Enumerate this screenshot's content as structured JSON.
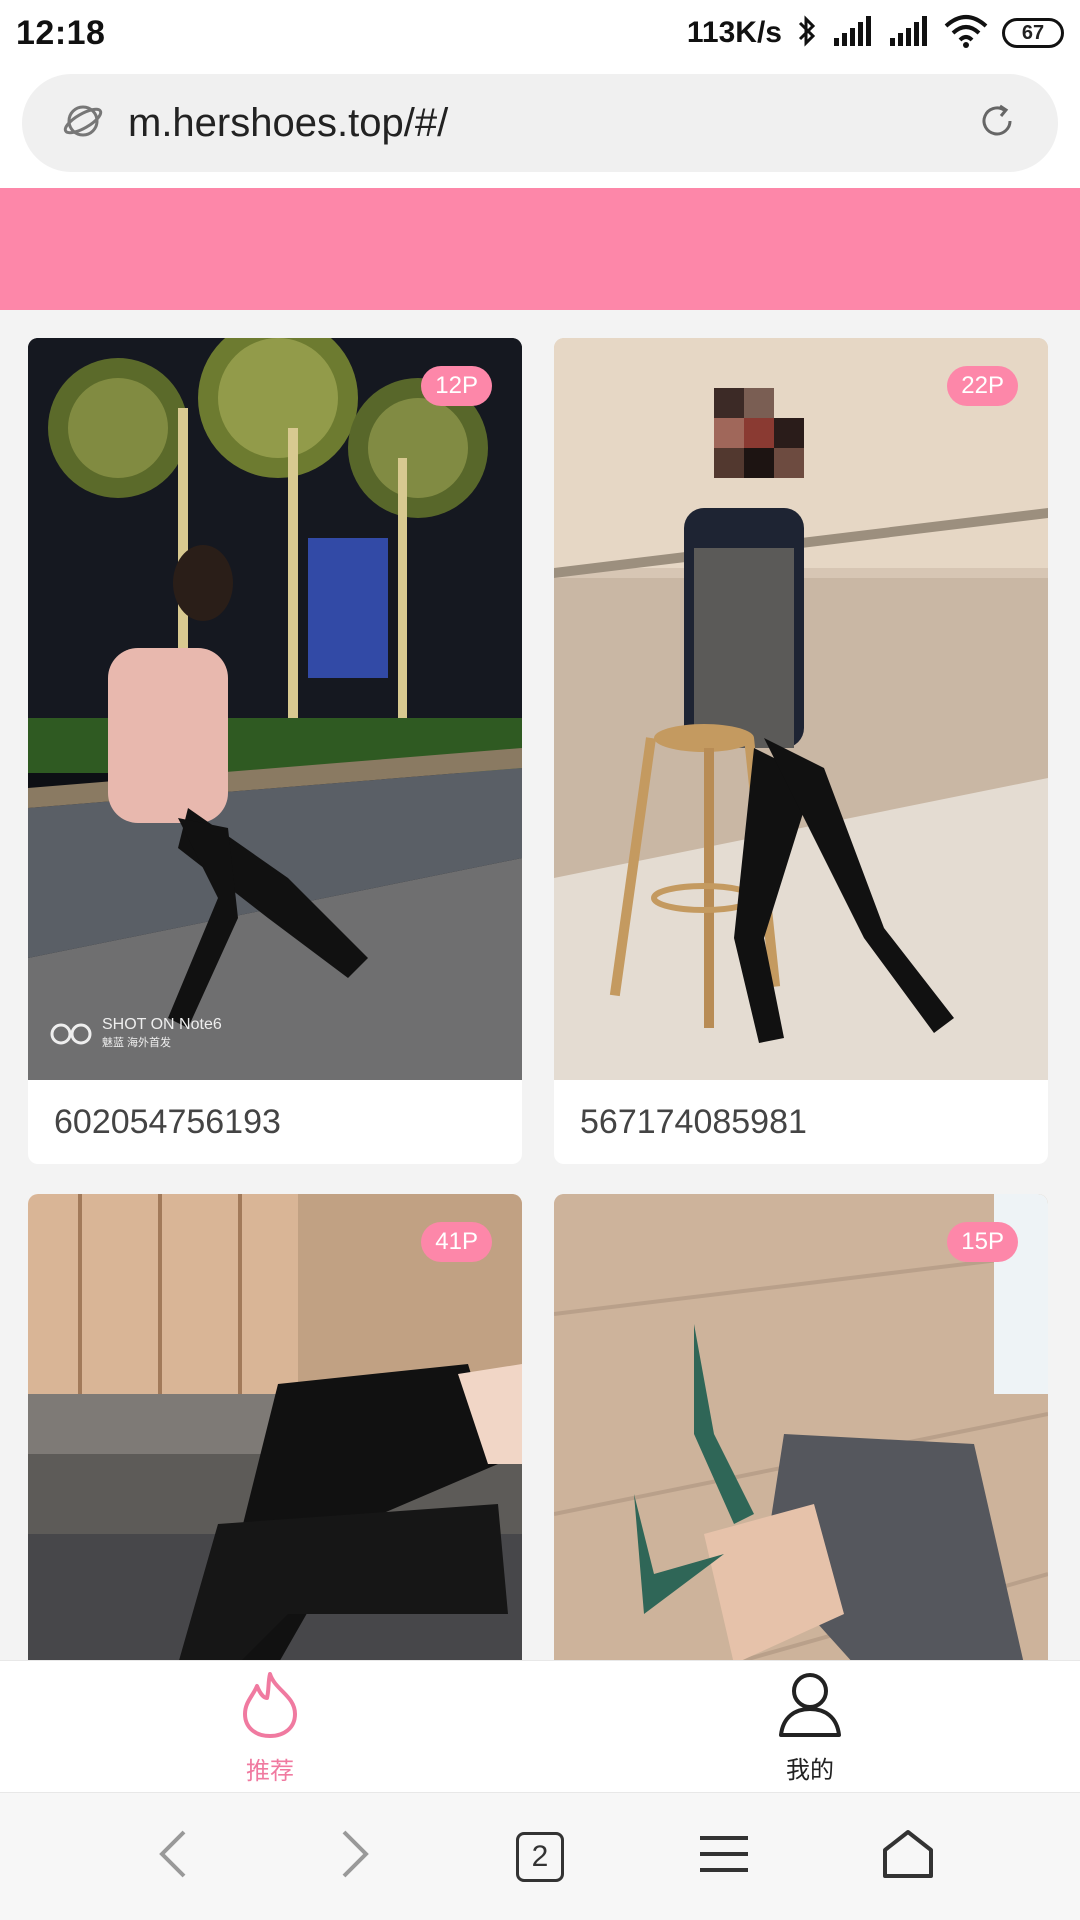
{
  "status": {
    "time": "12:18",
    "netspeed": "113K/s",
    "battery": "67"
  },
  "browser": {
    "url": "m.hershoes.top/#/",
    "tab_count": "2"
  },
  "cards": [
    {
      "badge": "12P",
      "caption": "602054756193",
      "watermark_line1": "SHOT ON Note6",
      "watermark_line2": "魅蓝 海外首发"
    },
    {
      "badge": "22P",
      "caption": "567174085981"
    },
    {
      "badge": "41P"
    },
    {
      "badge": "15P"
    }
  ],
  "tabbar": {
    "recommend": "推荐",
    "mine": "我的"
  },
  "colors": {
    "brand_pink": "#fd87a9",
    "active_tab": "#f07aa0"
  },
  "icons": [
    "signal-icon",
    "bluetooth-icon",
    "wifi-icon",
    "battery-icon",
    "site-icon",
    "reload-icon",
    "flame-icon",
    "user-icon",
    "back-icon",
    "forward-icon",
    "tabs-icon",
    "menu-icon",
    "home-icon"
  ]
}
